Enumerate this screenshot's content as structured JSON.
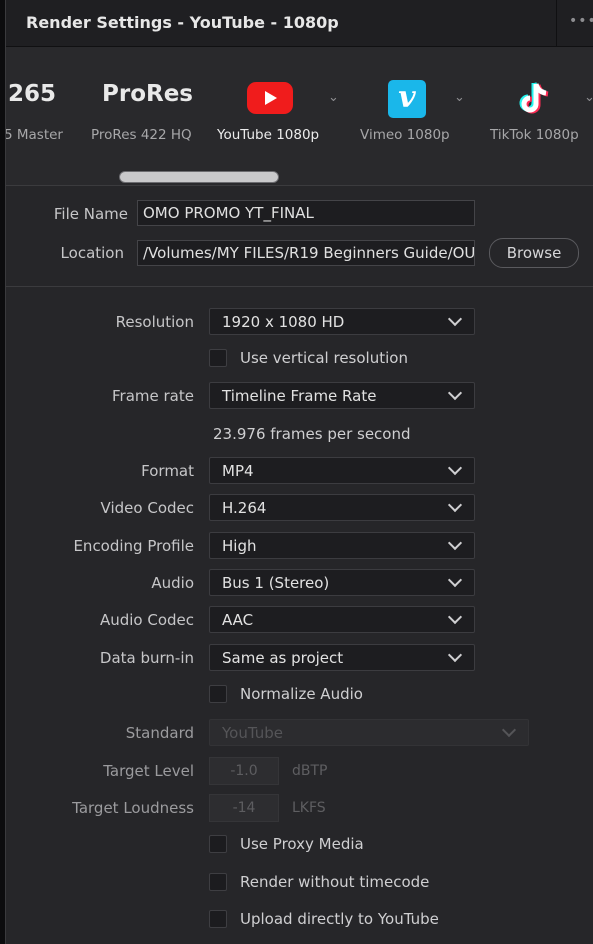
{
  "window": {
    "title": "Render Settings - YouTube - 1080p",
    "menu_icon": "more-dots-icon"
  },
  "presets": [
    {
      "big": "265",
      "label": "5 Master",
      "icon": "h265-text",
      "has_dropdown": false
    },
    {
      "big": "ProRes",
      "label": "ProRes 422 HQ",
      "icon": "prores-text",
      "has_dropdown": false
    },
    {
      "big": "",
      "label": "YouTube 1080p",
      "icon": "youtube-icon",
      "has_dropdown": true,
      "selected": true
    },
    {
      "big": "",
      "label": "Vimeo 1080p",
      "icon": "vimeo-icon",
      "has_dropdown": true
    },
    {
      "big": "",
      "label": "TikTok 1080p",
      "icon": "tiktok-icon",
      "has_dropdown": true
    }
  ],
  "file": {
    "name_label": "File Name",
    "name_value": "OMO PROMO YT_FINAL",
    "location_label": "Location",
    "location_value": "/Volumes/MY FILES/R19 Beginners Guide/OU",
    "browse_label": "Browse"
  },
  "settings": {
    "resolution_label": "Resolution",
    "resolution_value": "1920 x 1080 HD",
    "vertical_res_label": "Use vertical resolution",
    "vertical_res_checked": false,
    "frame_rate_label": "Frame rate",
    "frame_rate_value": "Timeline Frame Rate",
    "fps_info": "23.976 frames per second",
    "format_label": "Format",
    "format_value": "MP4",
    "video_codec_label": "Video Codec",
    "video_codec_value": "H.264",
    "encoding_profile_label": "Encoding Profile",
    "encoding_profile_value": "High",
    "audio_label": "Audio",
    "audio_value": "Bus 1 (Stereo)",
    "audio_codec_label": "Audio Codec",
    "audio_codec_value": "AAC",
    "burnin_label": "Data burn-in",
    "burnin_value": "Same as project",
    "normalize_label": "Normalize Audio",
    "normalize_checked": false,
    "standard_label": "Standard",
    "standard_value": "YouTube",
    "target_level_label": "Target Level",
    "target_level_value": "-1.0",
    "target_level_unit": "dBTP",
    "target_loudness_label": "Target Loudness",
    "target_loudness_value": "-14",
    "target_loudness_unit": "LKFS",
    "proxy_label": "Use Proxy Media",
    "proxy_checked": false,
    "no_timecode_label": "Render without timecode",
    "no_timecode_checked": false,
    "upload_label": "Upload directly to YouTube",
    "upload_checked": false
  },
  "colors": {
    "panel": "#262629",
    "field": "#1d1d20",
    "youtube_red": "#f01c1c",
    "vimeo_blue": "#1ab7ea"
  }
}
